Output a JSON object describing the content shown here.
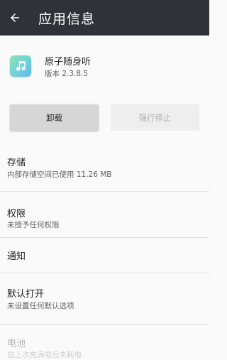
{
  "header": {
    "title": "应用信息"
  },
  "app": {
    "name": "原子随身听",
    "version": "版本 2.3.8.5"
  },
  "buttons": {
    "uninstall": "卸载",
    "force_stop": "强行停止"
  },
  "sections": {
    "storage": {
      "title": "存储",
      "subtitle": "内部存储空间已使用 11.26 MB"
    },
    "permissions": {
      "title": "权限",
      "subtitle": "未授予任何权限"
    },
    "notifications": {
      "title": "通知"
    },
    "default_open": {
      "title": "默认打开",
      "subtitle": "未设置任何默认选项"
    },
    "battery": {
      "title": "电池",
      "subtitle": "自上次充满电后未耗电"
    }
  }
}
